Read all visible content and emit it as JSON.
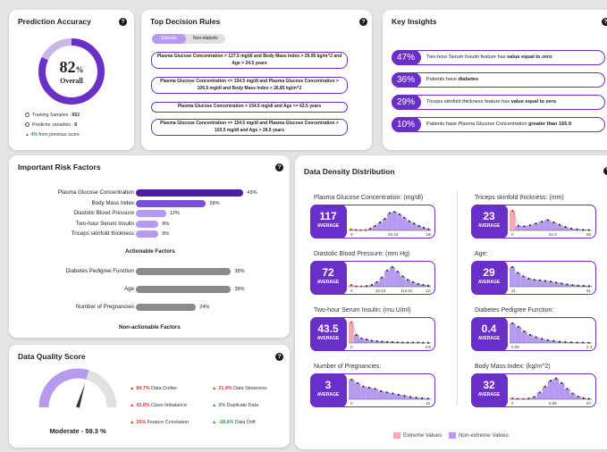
{
  "accuracy": {
    "title": "Prediction Accuracy",
    "value": "82",
    "unit": "%",
    "caption": "Overall",
    "fraction": 0.82,
    "training_label": "Training Samples : ",
    "training_value": "652",
    "predictor_label": "Predictor variables : ",
    "predictor_value": "8",
    "change_value": "4%",
    "change_label": " from previous score",
    "accent": "#6a2fc9"
  },
  "rules": {
    "title": "Top Decision Rules",
    "tab_active": "Diabetic",
    "tab_inactive": "Non-diabetic",
    "items": [
      "Plasma Glucose Concentration > 127.5 mg/dl and Body Mass Index > 29.95 kg/m^2 and Age > 24.5 years",
      "Plasma Glucose Concentration <= 154.5 mg/dl and Plasma Glucose Concentration > 106.5 mg/dl and Body Mass Index > 26.85 kg/m^2",
      "Plasma Glucose Concentration > 154.5 mg/dl and Age <= 62.5 years",
      "Plasma Glucose Concentration <= 154.5 mg/dl and Plasma Glucose Concentration > 103.5 mg/dl and Age > 28.5 years"
    ]
  },
  "insights": {
    "title": "Key Insights",
    "items": [
      {
        "pct": "47%",
        "pre": "Two-hour Serum Insulin feature has ",
        "bold": "value equal to zero",
        "post": ""
      },
      {
        "pct": "36%",
        "pre": "Patients have ",
        "bold": "diabetes",
        "post": ""
      },
      {
        "pct": "29%",
        "pre": "Triceps skinfold thickness feature has ",
        "bold": "value equal to zero",
        "post": ""
      },
      {
        "pct": "10%",
        "pre": "Patients have Plasma Glucose Concentration ",
        "bold": "greater than 165.9",
        "post": ""
      }
    ]
  },
  "risk": {
    "title": "Important Risk Factors",
    "actionable_label": "Actionable Factors",
    "nonactionable_label": "Non-actionable Factors",
    "actionable": [
      {
        "name": "Plasma Glucose Concentration",
        "value": 43,
        "label": "43%"
      },
      {
        "name": "Body Mass Index",
        "value": 28,
        "label": "28%"
      },
      {
        "name": "Diastolic Blood Pressure",
        "value": 12,
        "label": "12%"
      },
      {
        "name": "Two-hour Serum Insulin",
        "value": 9,
        "label": "9%"
      },
      {
        "name": "Triceps skinfold thickness",
        "value": 9,
        "label": "9%"
      }
    ],
    "nonactionable": [
      {
        "name": "Diabetes Pedigree Function",
        "value": 38,
        "label": "38%"
      },
      {
        "name": "Age",
        "value": 38,
        "label": "38%"
      },
      {
        "name": "Number of Pregnancies",
        "value": 24,
        "label": "24%"
      }
    ],
    "colors": [
      "#4b1fa0",
      "#7b4fd8",
      "#b79af0",
      "#b79af0",
      "#b79af0"
    ],
    "gray": "#8a8a8a"
  },
  "quality": {
    "title": "Data Quality Score",
    "score_label": "Moderate - 59.3 %",
    "score": 59.3,
    "items": [
      {
        "value": "84.7%",
        "label": " Data Outlier",
        "dir": "up",
        "color": "#d9373a"
      },
      {
        "value": "21.4%",
        "label": " Data Skewness",
        "dir": "up",
        "color": "#d9373a"
      },
      {
        "value": "43.8%",
        "label": " Class Imbalance",
        "dir": "up",
        "color": "#d9373a"
      },
      {
        "value": "0%",
        "label": " Duplicate Data",
        "dir": "up",
        "color": "#2e9b3a"
      },
      {
        "value": "25%",
        "label": " Feature Correlation",
        "dir": "up",
        "color": "#d9373a"
      },
      {
        "value": "-28.6%",
        "label": " Data Drift",
        "dir": "up",
        "color": "#2e9b3a"
      }
    ]
  },
  "density": {
    "title": "Data Density Distribution",
    "legend_extreme": "Extreme Values",
    "legend_nonextreme": "Non-extreme Values",
    "extreme_color": "#f4a9b4",
    "nonextreme_color": "#b79af0",
    "avg_label": "AVERAGE",
    "features": [
      {
        "name": "Plasma Glucose Concentration: (mg/dl)",
        "avg": "117",
        "ticks": [
          "0",
          "26.33",
          "199"
        ],
        "heights": [
          0.05,
          0.03,
          0.02,
          0.02,
          0.08,
          0.2,
          0.35,
          0.5,
          0.75,
          0.8,
          0.7,
          0.55,
          0.4,
          0.3,
          0.2,
          0.12,
          0.06
        ],
        "extreme_bins": 4
      },
      {
        "name": "Triceps skinfold thickness: (mm)",
        "avg": "23",
        "ticks": [
          "0",
          "52.8",
          "99"
        ],
        "heights": [
          0.85,
          0.2,
          0.18,
          0.22,
          0.3,
          0.38,
          0.45,
          0.35,
          0.25,
          0.15,
          0.08,
          0.05,
          0.03,
          0.02
        ],
        "extreme_bins": 1
      },
      {
        "name": "Diastolic Blood Pressure: (mm Hg)",
        "avg": "72",
        "ticks": [
          "0",
          "32.53",
          "113.52",
          "122"
        ],
        "heights": [
          0.08,
          0.02,
          0.02,
          0.03,
          0.08,
          0.2,
          0.4,
          0.7,
          0.85,
          0.65,
          0.45,
          0.3,
          0.2,
          0.12,
          0.08,
          0.05
        ],
        "extreme_bins": 3
      },
      {
        "name": "Age:",
        "avg": "29",
        "ticks": [
          "21",
          "81"
        ],
        "heights": [
          0.85,
          0.6,
          0.45,
          0.35,
          0.3,
          0.28,
          0.25,
          0.22,
          0.18,
          0.14,
          0.1,
          0.07,
          0.05,
          0.04,
          0.03
        ],
        "extreme_bins": 0
      },
      {
        "name": "Two-hour Serum Insulin: (mu U/ml)",
        "avg": "43.5",
        "ticks": [
          "0",
          "846"
        ],
        "heights": [
          0.9,
          0.35,
          0.2,
          0.15,
          0.1,
          0.08,
          0.06,
          0.05,
          0.04,
          0.03,
          0.02,
          0.02,
          0.02,
          0.02,
          0.01,
          0.01
        ],
        "extreme_bins": 1
      },
      {
        "name": "Diabetes Pedigree Function:",
        "avg": "0.4",
        "ticks": [
          "0.08",
          "2.39"
        ],
        "heights": [
          0.85,
          0.7,
          0.5,
          0.35,
          0.25,
          0.18,
          0.12,
          0.09,
          0.06,
          0.04,
          0.03,
          0.02,
          0.02,
          0.01
        ],
        "extreme_bins": 0
      },
      {
        "name": "Number of Pregnancies:",
        "avg": "3",
        "ticks": [
          "0",
          "15"
        ],
        "heights": [
          0.85,
          0.7,
          0.55,
          0.5,
          0.45,
          0.35,
          0.3,
          0.25,
          0.2,
          0.15,
          0.1,
          0.07,
          0.05,
          0.03
        ],
        "extreme_bins": 0
      },
      {
        "name": "Body Mass Index: (kg/m^2)",
        "avg": "32",
        "ticks": [
          "0",
          "8.95",
          "67.1"
        ],
        "heights": [
          0.05,
          0.02,
          0.02,
          0.03,
          0.1,
          0.3,
          0.55,
          0.8,
          0.9,
          0.7,
          0.45,
          0.25,
          0.12,
          0.05,
          0.02
        ],
        "extreme_bins": 3
      }
    ]
  }
}
